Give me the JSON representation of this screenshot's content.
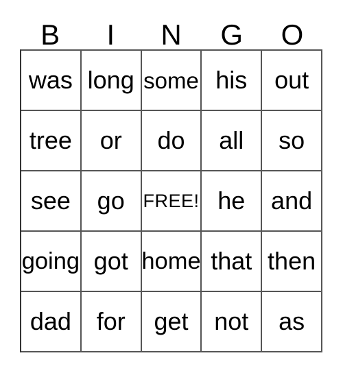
{
  "card": {
    "type": "bingo-card",
    "columns": 5,
    "rows": 5,
    "header": {
      "letters": [
        "B",
        "I",
        "N",
        "G",
        "O"
      ]
    },
    "grid": [
      [
        {
          "text": "was",
          "size": "normal",
          "free": false
        },
        {
          "text": "long",
          "size": "normal",
          "free": false
        },
        {
          "text": "some",
          "size": "tight",
          "free": false
        },
        {
          "text": "his",
          "size": "normal",
          "free": false
        },
        {
          "text": "out",
          "size": "normal",
          "free": false
        }
      ],
      [
        {
          "text": "tree",
          "size": "normal",
          "free": false
        },
        {
          "text": "or",
          "size": "normal",
          "free": false
        },
        {
          "text": "do",
          "size": "normal",
          "free": false
        },
        {
          "text": "all",
          "size": "normal",
          "free": false
        },
        {
          "text": "so",
          "size": "normal",
          "free": false
        }
      ],
      [
        {
          "text": "see",
          "size": "normal",
          "free": false
        },
        {
          "text": "go",
          "size": "normal",
          "free": false
        },
        {
          "text": "FREE!",
          "size": "free",
          "free": true
        },
        {
          "text": "he",
          "size": "normal",
          "free": false
        },
        {
          "text": "and",
          "size": "normal",
          "free": false
        }
      ],
      [
        {
          "text": "going",
          "size": "snug",
          "free": false
        },
        {
          "text": "got",
          "size": "normal",
          "free": false
        },
        {
          "text": "home",
          "size": "snug",
          "free": false
        },
        {
          "text": "that",
          "size": "normal",
          "free": false
        },
        {
          "text": "then",
          "size": "normal",
          "free": false
        }
      ],
      [
        {
          "text": "dad",
          "size": "normal",
          "free": false
        },
        {
          "text": "for",
          "size": "normal",
          "free": false
        },
        {
          "text": "get",
          "size": "normal",
          "free": false
        },
        {
          "text": "not",
          "size": "normal",
          "free": false
        },
        {
          "text": "as",
          "size": "normal",
          "free": false
        }
      ]
    ],
    "colors": {
      "background": "#ffffff",
      "text": "#000000",
      "grid_line": "#555555"
    }
  }
}
